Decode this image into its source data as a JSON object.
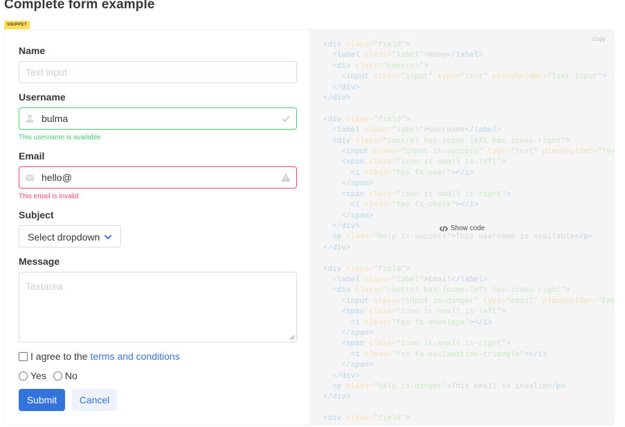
{
  "page": {
    "title": "Complete form example",
    "tag": "SNIPPET"
  },
  "form": {
    "name": {
      "label": "Name",
      "placeholder": "Text input"
    },
    "username": {
      "label": "Username",
      "value": "bulma",
      "help": "This username is available"
    },
    "email": {
      "label": "Email",
      "value": "hello@",
      "help": "This email is invalid"
    },
    "subject": {
      "label": "Subject",
      "selected": "Select dropdown"
    },
    "message": {
      "label": "Message",
      "placeholder": "Textarea"
    },
    "agree": {
      "text": "I agree to the",
      "link": "terms and conditions"
    },
    "radios": [
      {
        "label": "Yes"
      },
      {
        "label": "No"
      }
    ],
    "submit_label": "Submit",
    "cancel_label": "Cancel"
  },
  "code_panel": {
    "copy_label": "Copy",
    "show_code_label": "Show code"
  },
  "colors": {
    "success": "#48c774",
    "danger": "#f14668",
    "primary": "#3273dc",
    "tag": "#ffdd57"
  }
}
